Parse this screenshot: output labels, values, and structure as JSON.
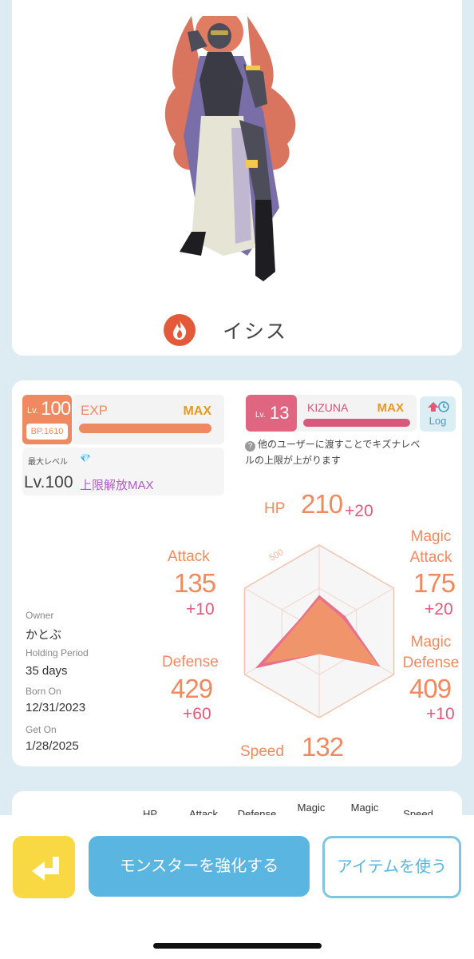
{
  "monster": {
    "name": "イシス",
    "element_icon": "fire-icon"
  },
  "level": {
    "prefix": "Lv.",
    "value": "100",
    "bp": "BP.1610",
    "exp_label": "EXP",
    "exp_status": "MAX",
    "exp_fill_fraction": 1.0,
    "max_level_label": "最大レベル",
    "max_level_value": "Lv.100",
    "limit_unlock_label": "上限解放MAX"
  },
  "kizuna": {
    "prefix": "Lv.",
    "value": "13",
    "label": "KIZUNA",
    "status": "MAX",
    "fill_fraction": 1.0,
    "log_label": "Log",
    "note": "他のユーザーに渡すことでキズナレベルの上限が上がります"
  },
  "owner_info": {
    "owner_label": "Owner",
    "owner_value": "かとぶ",
    "holding_label": "Holding Period",
    "holding_value": "35 days",
    "born_label": "Born On",
    "born_value": "12/31/2023",
    "get_label": "Get On",
    "get_value": "1/28/2025"
  },
  "stats": {
    "hp": {
      "name": "HP",
      "value": "210",
      "bonus": "+20"
    },
    "magic_attack": {
      "name": "Magic Attack",
      "value": "175",
      "bonus": "+20"
    },
    "magic_defense": {
      "name": "Magic Defense",
      "value": "409",
      "bonus": "+10"
    },
    "speed": {
      "name": "Speed",
      "value": "132"
    },
    "defense": {
      "name": "Defense",
      "value": "429",
      "bonus": "+60"
    },
    "attack": {
      "name": "Attack",
      "value": "135",
      "bonus": "+10"
    },
    "radar_scale_label": "500",
    "radar_max": 500,
    "radar_order": [
      "hp",
      "magic_attack",
      "magic_defense",
      "speed",
      "defense",
      "attack"
    ],
    "radar_values": [
      210,
      175,
      409,
      132,
      429,
      135
    ],
    "radar_base_values": [
      190,
      155,
      399,
      132,
      369,
      125
    ]
  },
  "table_headers": [
    "HP",
    "Attack",
    "Defense",
    "Magic",
    "Magic",
    "Speed"
  ],
  "buttons": {
    "enhance": "モンスターを強化する",
    "use_item": "アイテムを使う"
  },
  "colors": {
    "accent_orange": "#ef8a60",
    "kizuna_pink": "#e06580",
    "primary_blue": "#5ab6e0",
    "back_yellow": "#f8d944"
  }
}
